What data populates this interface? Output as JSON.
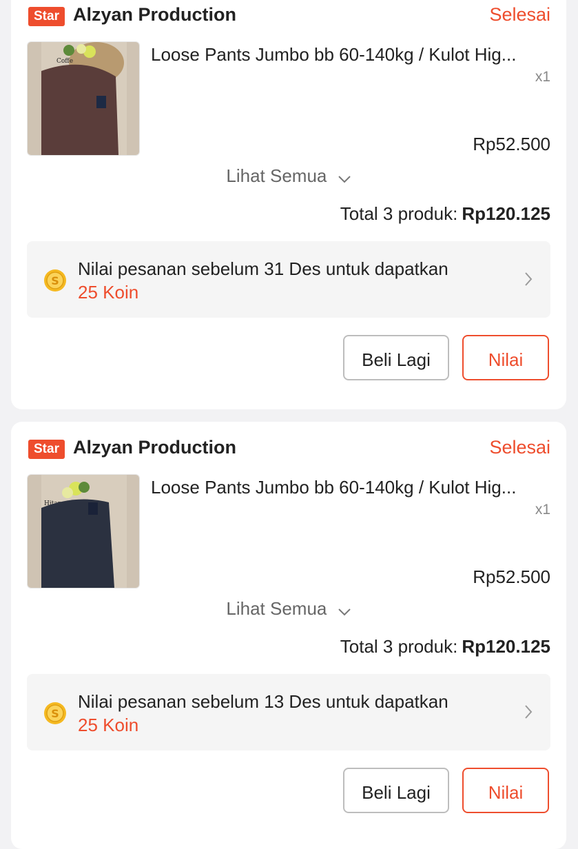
{
  "orders": [
    {
      "badge": "Star",
      "shop_name": "Alzyan Production",
      "status": "Selesai",
      "product_title": "Loose Pants Jumbo bb 60-140kg / Kulot Hig...",
      "quantity": "x1",
      "price": "Rp52.500",
      "thumb_label": "Coffe",
      "thumb_color": "#5a3d3a",
      "see_all": "Lihat Semua",
      "total_label": "Total 3 produk:",
      "total_amount": "Rp120.125",
      "coin_text": "Nilai pesanan sebelum 31 Des untuk dapatkan",
      "coin_reward": "25 Koin",
      "buy_again": "Beli Lagi",
      "rate": "Nilai"
    },
    {
      "badge": "Star",
      "shop_name": "Alzyan Production",
      "status": "Selesai",
      "product_title": "Loose Pants Jumbo bb 60-140kg / Kulot Hig...",
      "quantity": "x1",
      "price": "Rp52.500",
      "thumb_label": "Hitam",
      "thumb_color": "#2b3140",
      "see_all": "Lihat Semua",
      "total_label": "Total 3 produk:",
      "total_amount": "Rp120.125",
      "coin_text": "Nilai pesanan sebelum 13 Des untuk dapatkan",
      "coin_reward": "25 Koin",
      "buy_again": "Beli Lagi",
      "rate": "Nilai"
    }
  ],
  "colors": {
    "accent": "#ee4d2d",
    "coin": "#f5b921"
  },
  "icons": {
    "coin": "coin-icon",
    "chevron_down": "chevron-down-icon",
    "chevron_right": "chevron-right-icon"
  }
}
